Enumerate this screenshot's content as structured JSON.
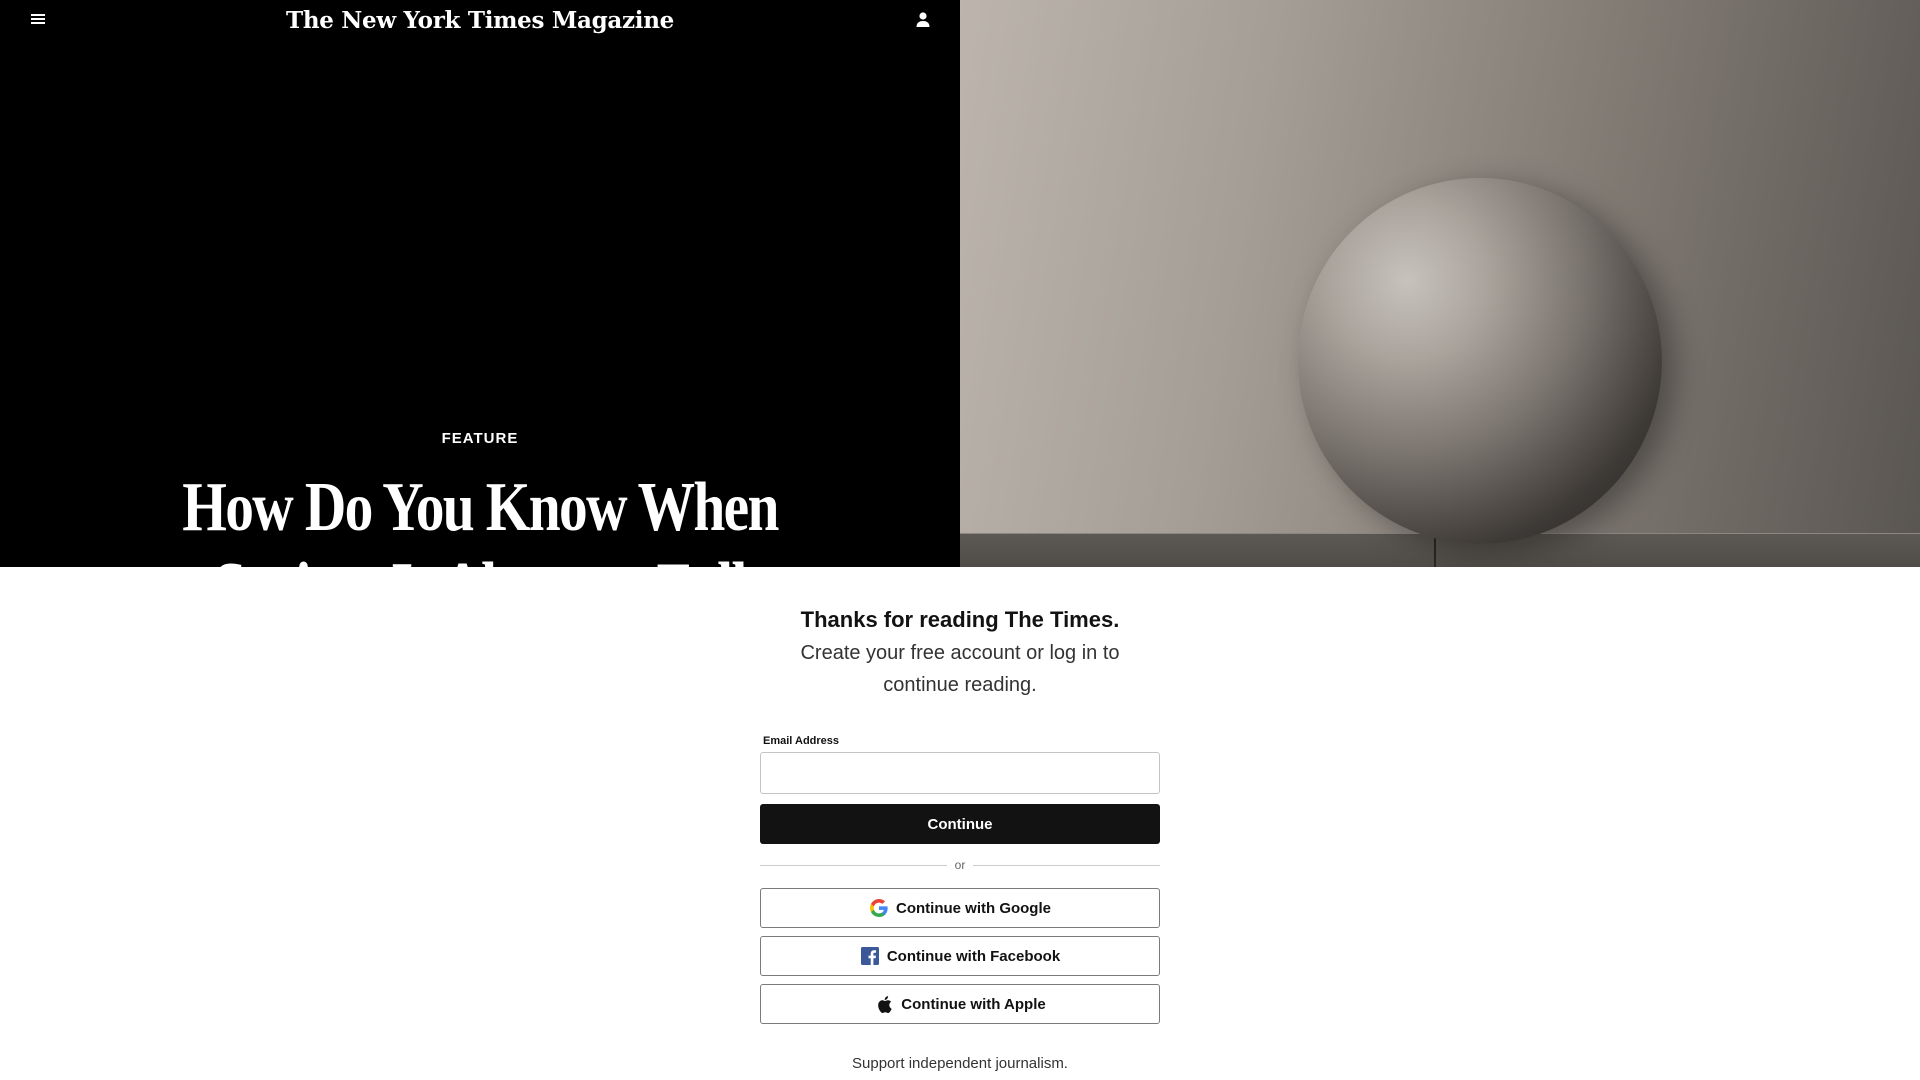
{
  "header": {
    "masthead": "The New York Times Magazine",
    "menu_icon": "hamburger-menu-icon",
    "account_icon": "user-account-icon"
  },
  "article": {
    "kicker": "FEATURE",
    "headline": "How Do You Know When Society Is About to Fall Apart?"
  },
  "regwall": {
    "title": "Thanks for reading The Times.",
    "subtitle": "Create your free account or log in to continue reading.",
    "email_label": "Email Address",
    "email_value": "",
    "email_placeholder": "",
    "continue_label": "Continue",
    "or_label": "or",
    "google_label": "Continue with Google",
    "facebook_label": "Continue with Facebook",
    "apple_label": "Continue with Apple",
    "support_text": "Support independent journalism."
  },
  "colors": {
    "hero_bg": "#000000",
    "button_dark": "#121212",
    "facebook_blue": "#3b5998",
    "text_dark": "#121212"
  }
}
